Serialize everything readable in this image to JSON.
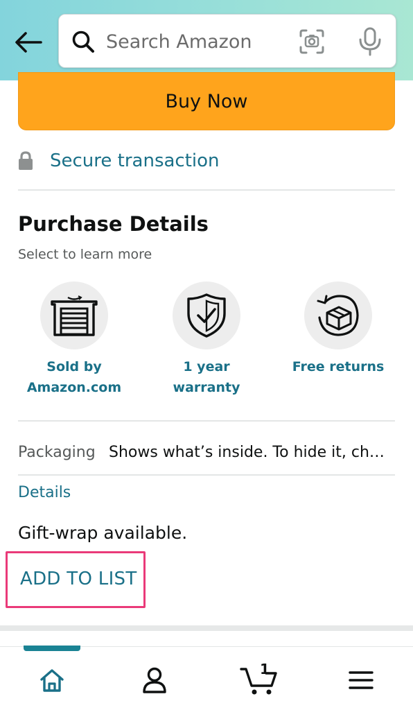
{
  "header": {
    "search_placeholder": "Search Amazon",
    "icons": {
      "back": "back-arrow-icon",
      "search": "search-icon",
      "camera": "camera-scan-icon",
      "mic": "microphone-icon"
    }
  },
  "buy_now": {
    "label": "Buy Now"
  },
  "secure": {
    "label": "Secure transaction"
  },
  "purchase_details": {
    "title": "Purchase Details",
    "subtitle": "Select to learn more",
    "features": [
      {
        "line1": "Sold by",
        "line2": "Amazon.com",
        "icon": "warehouse-icon"
      },
      {
        "line1": "1 year",
        "line2": "warranty",
        "icon": "shield-check-icon"
      },
      {
        "line1": "Free returns",
        "line2": "",
        "icon": "return-box-icon"
      }
    ]
  },
  "packaging": {
    "key": "Packaging",
    "value": "Shows what’s inside. To hide it, ch…"
  },
  "details": {
    "link": "Details",
    "gift_wrap": "Gift-wrap available."
  },
  "add_to_list": {
    "label": "ADD TO LIST"
  },
  "bottom_nav": {
    "items": [
      "home-icon",
      "account-icon",
      "cart-icon",
      "menu-icon"
    ],
    "cart_count": "1"
  },
  "colors": {
    "accent": "#1a7088",
    "buy_now": "#ffa41c",
    "highlight": "#ea3a79"
  }
}
